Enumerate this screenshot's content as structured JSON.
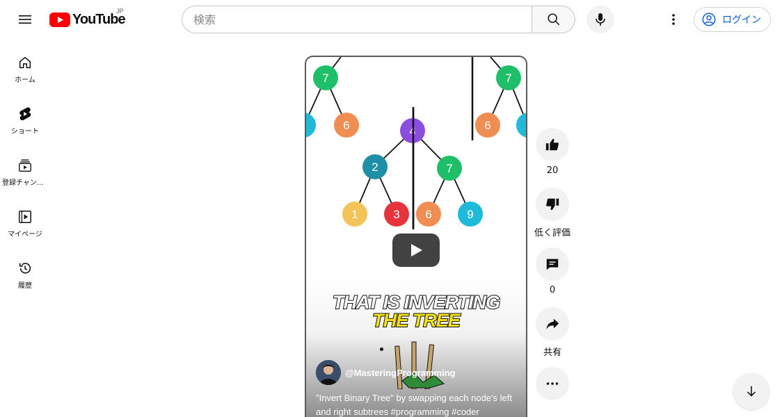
{
  "header": {
    "logo_text": "YouTube",
    "country_code": "JP",
    "search_placeholder": "検索",
    "login_label": "ログイン"
  },
  "guide": {
    "items": [
      {
        "label": "ホーム",
        "icon": "home-icon"
      },
      {
        "label": "ショート",
        "icon": "shorts-icon"
      },
      {
        "label": "登録チャンネル",
        "icon": "subscriptions-icon"
      },
      {
        "label": "マイページ",
        "icon": "library-icon"
      },
      {
        "label": "履歴",
        "icon": "history-icon"
      }
    ]
  },
  "video": {
    "caption_line1": "THAT IS INVERTING",
    "caption_line2": "THE TREE",
    "channel_handle": "@MasteringProgramming",
    "description": "\"Invert Binary Tree\" by swapping each node's left and right subtrees #programming #coder",
    "tree": {
      "root": "4",
      "level2": [
        "2",
        "7"
      ],
      "leaves": [
        "1",
        "3",
        "6",
        "9"
      ],
      "top_left": [
        "7",
        "6"
      ],
      "top_right": [
        "7",
        "6"
      ]
    }
  },
  "actions": {
    "like_count": "20",
    "dislike_label": "低く評価",
    "comment_count": "0",
    "share_label": "共有"
  },
  "colors": {
    "brand_red": "#ff0000",
    "link_blue": "#065fd4",
    "node_purple": "#8a4de0",
    "node_teal": "#1f8fa8",
    "node_green": "#1fbf6a",
    "node_yellow": "#f4c35a",
    "node_red": "#e7333c",
    "node_orange": "#f08d52",
    "node_cyan": "#1fb9d9"
  }
}
